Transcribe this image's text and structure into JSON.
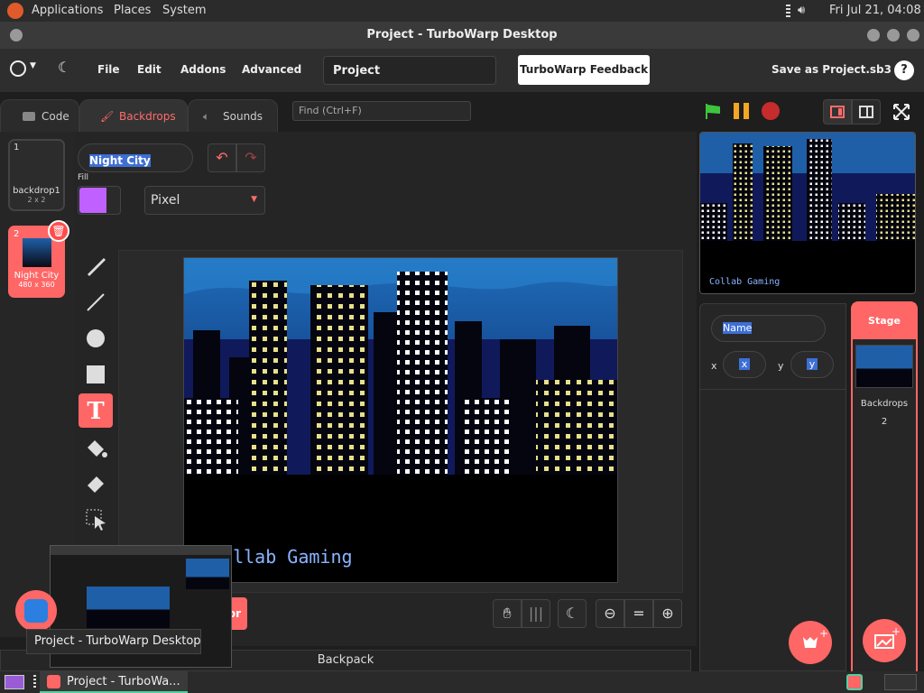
{
  "top_panel": {
    "menus": [
      "Applications",
      "Places",
      "System"
    ],
    "clock": "Fri Jul 21, 04:08"
  },
  "window": {
    "title": "Project - TurboWarp Desktop"
  },
  "menubar": {
    "file": "File",
    "edit": "Edit",
    "addons": "Addons",
    "advanced": "Advanced",
    "project_title": "Project",
    "feedback": "TurboWarp Feedback",
    "save": "Save as Project.sb3",
    "help": "?"
  },
  "tabs": [
    {
      "label": "Code"
    },
    {
      "label": "Backdrops"
    },
    {
      "label": "Sounds"
    }
  ],
  "find_placeholder": "Find (Ctrl+F)",
  "costumes": [
    {
      "index": "1",
      "name": "backdrop1",
      "size": "2 x 2"
    },
    {
      "index": "2",
      "name": "Night City",
      "size": "480 x 360"
    }
  ],
  "paint": {
    "costume_name": "Night City",
    "fill_label": "Fill",
    "fill_color": "#c060ff",
    "mode": "Pixel",
    "canvas_text": "Collab Gaming",
    "convert_button": "or"
  },
  "stage": {
    "caption": "Collab Gaming"
  },
  "sprite_info": {
    "name_placeholder": "Name",
    "x_label": "x",
    "y_label": "y",
    "x_value": "x",
    "y_value": "y"
  },
  "stage_pane": {
    "header": "Stage",
    "backdrops_label": "Backdrops",
    "backdrops_count": "2"
  },
  "backpack": "Backpack",
  "tooltip": "Project - TurboWarp Desktop",
  "taskbar": {
    "item": "Project - TurboWa..."
  },
  "colors": {
    "accent": "#ff6b6b",
    "sky": "#1f5fa8",
    "building": "#0a0a14",
    "window_light": "#e8e08a"
  }
}
